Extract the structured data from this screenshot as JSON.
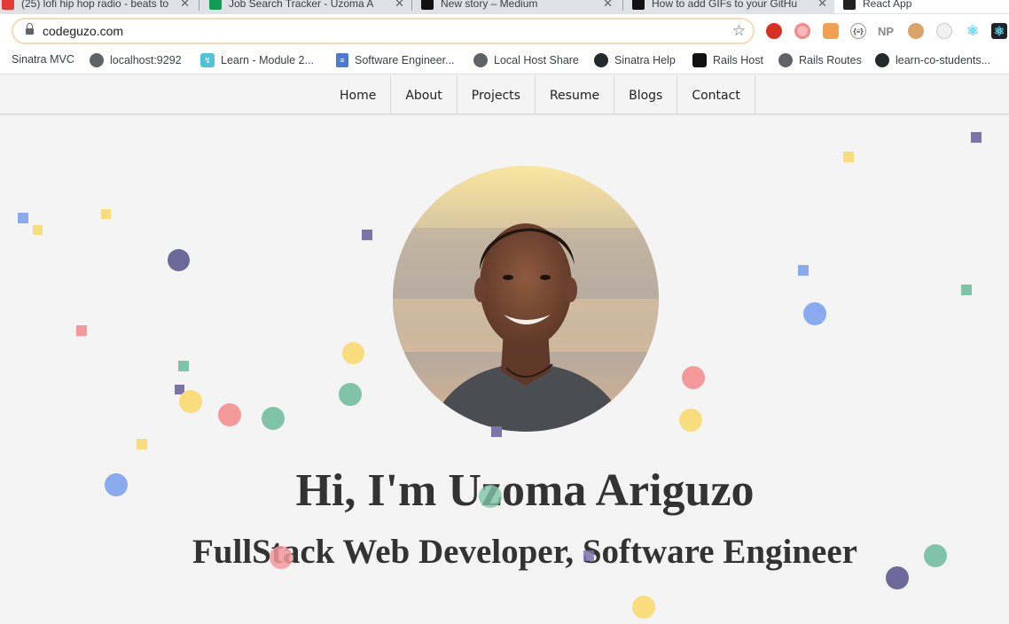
{
  "browser": {
    "tabs": [
      {
        "title": "(25) lofi hip hop radio - beats to",
        "favicon_color": "#e53935"
      },
      {
        "title": "Job Search Tracker - Uzoma A",
        "favicon_color": "#0f9d58"
      },
      {
        "title": "New story – Medium",
        "favicon_color": "#111111"
      },
      {
        "title": "How to add GIFs to your GitHu",
        "favicon_color": "#111111"
      },
      {
        "title": "React App",
        "favicon_color": "#222222"
      }
    ],
    "url": "codeguzo.com",
    "extensions": [
      {
        "name": "shield-extension-icon",
        "color": "#d93025",
        "glyph": ""
      },
      {
        "name": "donut-extension-icon",
        "color": "#f28b82",
        "glyph": ""
      },
      {
        "name": "metamask-extension-icon",
        "color": "#e8821e",
        "glyph": ""
      },
      {
        "name": "json-extension-icon",
        "color": "#ffffff",
        "glyph": "{≡}"
      },
      {
        "name": "np-extension-icon",
        "color": "#ffffff",
        "glyph": "NP"
      },
      {
        "name": "cookie-extension-icon",
        "color": "#c58c4a",
        "glyph": ""
      },
      {
        "name": "bear-extension-icon",
        "color": "#eeeeee",
        "glyph": ""
      },
      {
        "name": "react-extension-icon",
        "color": "#ffffff",
        "glyph": "⚛"
      },
      {
        "name": "react-devtools-extension-icon",
        "color": "#20232a",
        "glyph": "⚛"
      }
    ],
    "bookmarks": [
      {
        "label": "Sinatra MVC",
        "icon": "none"
      },
      {
        "label": "localhost:9292",
        "icon": "globe"
      },
      {
        "label": "Learn - Module 2...",
        "icon": "learn"
      },
      {
        "label": "Software Engineer...",
        "icon": "docs"
      },
      {
        "label": "Local Host Share",
        "icon": "globe"
      },
      {
        "label": "Sinatra Help",
        "icon": "github"
      },
      {
        "label": "Rails Host",
        "icon": "terminal"
      },
      {
        "label": "Rails Routes",
        "icon": "globe"
      },
      {
        "label": "learn-co-students...",
        "icon": "github"
      }
    ]
  },
  "site": {
    "nav": [
      "Home",
      "About",
      "Projects",
      "Resume",
      "Blogs",
      "Contact"
    ],
    "heading": "Hi, I'm Uzoma Ariguzo",
    "subheading": "FullStack Web Developer, Software Engineer"
  },
  "colors": {
    "purple": "#6e6799",
    "blue": "#8aaaf0",
    "yellow": "#f9dc7c",
    "green": "#7fc4a8",
    "red": "#f3999a"
  }
}
